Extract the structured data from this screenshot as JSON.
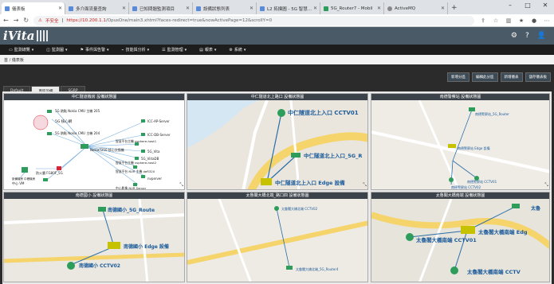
{
  "browser": {
    "tabs": [
      {
        "label": "儀表板",
        "active": true
      },
      {
        "label": "多介面流量查詢",
        "active": false
      },
      {
        "label": "已知問題監測項目",
        "active": false
      },
      {
        "label": "設備狀態列表",
        "active": false
      },
      {
        "label": "L2 拓撲圖 - 5G 智慧...",
        "active": false
      },
      {
        "label": "5G_Router7 - Mobil",
        "active": false
      },
      {
        "label": "ActiveMQ",
        "active": false
      }
    ],
    "security_warning": "不安全",
    "url_host": "https://10.200.1.1",
    "url_path": "/OpusOne/main3.xhtml?faces-redirect=true&nowActivePage=12&scrollY=0"
  },
  "brand": {
    "name": "iVita"
  },
  "menu": [
    "監測總覽",
    "監測圖",
    "事件與告警",
    "技能與分析",
    "監測管理",
    "報表",
    "系統"
  ],
  "breadcrumb": "首 / 儀表板",
  "actions": [
    "新增分區",
    "編輯此分區",
    "新增儀表",
    "儲存儀表板"
  ],
  "content_tabs": [
    "Default",
    "南區設備",
    "SGRP"
  ],
  "layout_label": "面版配置:",
  "layout_value": "10 個",
  "cards": [
    {
      "title": "中仁隧道機房 設備狀態圖"
    },
    {
      "title": "中仁隧道北上路口 設備狀態圖"
    },
    {
      "title": "南德警察站 設備狀態圖"
    },
    {
      "title": "南德國小 設備狀態圖"
    },
    {
      "title": "太魯閣大橋北端_路口四 設備狀態圖"
    },
    {
      "title": "太魯閣大橋南端 設備狀態圖"
    }
  ],
  "topo": {
    "core": "5G 核心網",
    "eq_room": "設備機房\n中壢機房",
    "nodes_left": [
      "5G 熱點 Nokia CMU 主機 205",
      "5G 熱點 Nokia CMU 主機 204",
      "Nokia7250 核心交換機",
      "防火牆 FG80F_5G",
      "中心 VM"
    ],
    "nodes_right": [
      "ICC-AP-Server",
      "ICC-DB-Server",
      "智慧平台主機 vsphere-host1",
      "5G_Vita",
      "5G_ViitaDB",
      "智慧平台主機 vsphere-host2",
      "智慧平台 NVR 主機 deR320",
      "nvperver",
      "中心影像 NVR Server"
    ]
  },
  "map1": {
    "cctv": "中仁隧道北上入口 CCTV01",
    "router": "中仁隧道北上入口_5G_R",
    "edge": "中仁隧道北上入口 Edge 設備"
  },
  "map2": {
    "router": "南德警察站_5G_Router",
    "edge": "南德警察站 Edge 設備",
    "cctv1": "南德警察站 CCTV01",
    "cctv2": "南德警察站 CCTV02"
  },
  "map3": {
    "router": "南德國小_5G_Route",
    "edge": "南德國小 Edge 設備",
    "cctv": "南德國小 CCTV02"
  },
  "map4": {
    "cctv": "太魯閣大橋北端 CCTV02",
    "router": "太魯閣大橋北端_5G_Router4"
  },
  "map5": {
    "router": "太魯",
    "edge": "太魯閣大橋南端 Edg",
    "cctv1": "太魯閣大橋南端 CCTV01",
    "cctv2": "太魯閣大橋南端 CCTV"
  }
}
